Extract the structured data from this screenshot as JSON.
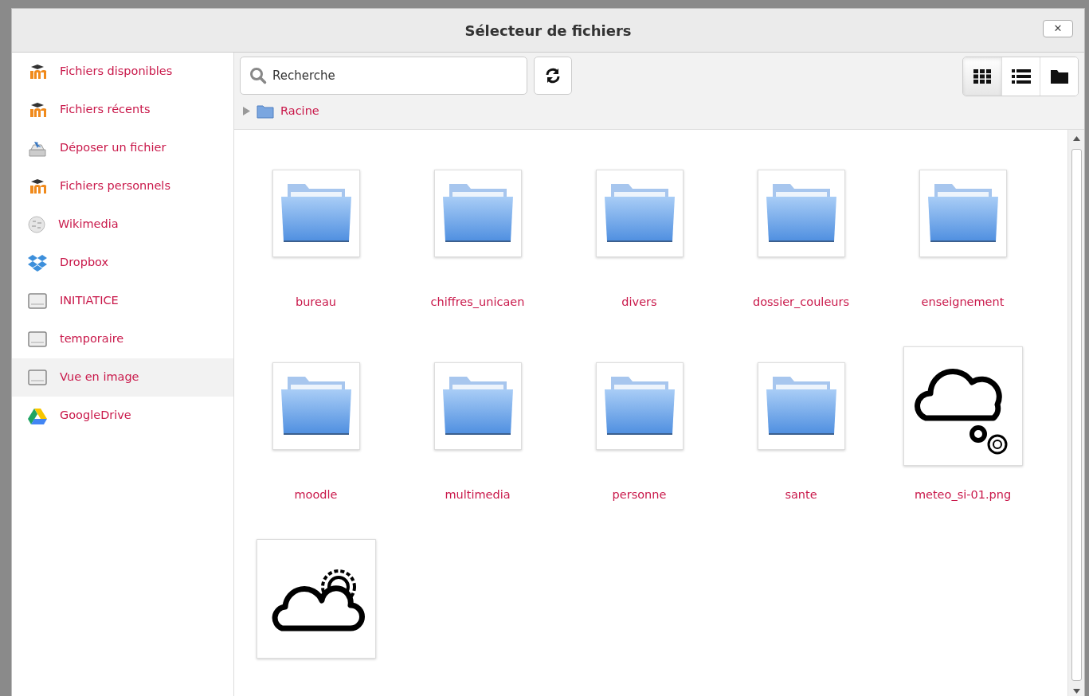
{
  "dialog": {
    "title": "Sélecteur de fichiers",
    "close_label": "✕"
  },
  "sidebar": {
    "items": [
      {
        "label": "Fichiers disponibles",
        "kind": "moodle",
        "selected": false
      },
      {
        "label": "Fichiers récents",
        "kind": "moodle",
        "selected": false
      },
      {
        "label": "Déposer un fichier",
        "kind": "upload",
        "selected": false
      },
      {
        "label": "Fichiers personnels",
        "kind": "moodle",
        "selected": false
      },
      {
        "label": "Wikimedia",
        "kind": "wiki",
        "selected": false
      },
      {
        "label": "Dropbox",
        "kind": "dropbox",
        "selected": false
      },
      {
        "label": "INITIATICE",
        "kind": "drive",
        "selected": false
      },
      {
        "label": "temporaire",
        "kind": "drive",
        "selected": false
      },
      {
        "label": "Vue en image",
        "kind": "drive",
        "selected": true
      },
      {
        "label": "GoogleDrive",
        "kind": "gdrive",
        "selected": false
      }
    ]
  },
  "toolbar": {
    "search": {
      "placeholder": "Recherche"
    },
    "views": [
      {
        "kind": "icons",
        "selected": true
      },
      {
        "kind": "list",
        "selected": false
      },
      {
        "kind": "tree",
        "selected": false
      }
    ]
  },
  "breadcrumb": {
    "label": "Racine"
  },
  "files": [
    {
      "name": "bureau",
      "kind": "folder"
    },
    {
      "name": "chiffres_unicaen",
      "kind": "folder"
    },
    {
      "name": "divers",
      "kind": "folder"
    },
    {
      "name": "dossier_couleurs",
      "kind": "folder"
    },
    {
      "name": "enseignement",
      "kind": "folder"
    },
    {
      "name": "moodle",
      "kind": "folder"
    },
    {
      "name": "multimedia",
      "kind": "folder"
    },
    {
      "name": "personne",
      "kind": "folder"
    },
    {
      "name": "sante",
      "kind": "folder"
    },
    {
      "name": "meteo_si-01.png",
      "kind": "image-cloud-gears"
    },
    {
      "kind": "image-cloud-sun"
    }
  ]
}
